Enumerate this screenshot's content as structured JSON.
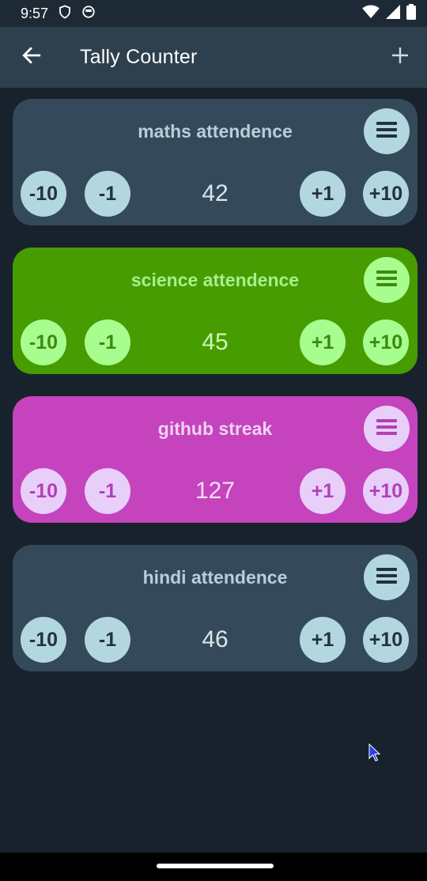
{
  "status_bar": {
    "time": "9:57"
  },
  "app_bar": {
    "title": "Tally Counter"
  },
  "counters": [
    {
      "name": "maths attendence",
      "count": "42",
      "bg": "#34495a",
      "btn_bg": "#b3d7df",
      "btn_text": "#233240",
      "title_color": "#b8cfd9",
      "count_color": "#dbe6ec"
    },
    {
      "name": "science attendence",
      "count": "45",
      "bg": "#469c00",
      "btn_bg": "#a8fd8f",
      "btn_text": "#3c8b10",
      "title_color": "#a9ef8c",
      "count_color": "#c9f7b8"
    },
    {
      "name": "github streak",
      "count": "127",
      "bg": "#c543bd",
      "btn_bg": "#e7cffa",
      "btn_text": "#b340b6",
      "title_color": "#f0d2f5",
      "count_color": "#f4dcf7"
    },
    {
      "name": "hindi attendence",
      "count": "46",
      "bg": "#34495a",
      "btn_bg": "#b3d7df",
      "btn_text": "#233240",
      "title_color": "#b8cfd9",
      "count_color": "#dbe6ec"
    }
  ],
  "buttons": {
    "minus10": "-10",
    "minus1": "-1",
    "plus1": "+1",
    "plus10": "+10"
  },
  "icons": {
    "back": "arrow-left-icon",
    "add": "plus-icon",
    "menu": "menu-icon"
  }
}
